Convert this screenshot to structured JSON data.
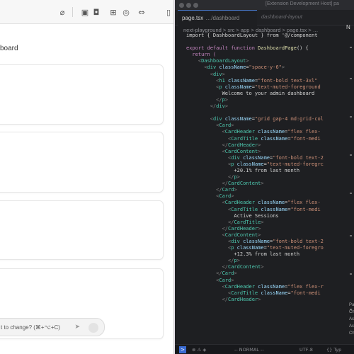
{
  "preview": {
    "board_text": "board",
    "toolbar_icons": [
      {
        "name": "attach-icon",
        "glyph": "⌀"
      },
      {
        "name": "screenshot-icon",
        "glyph": "▣"
      },
      {
        "name": "camera-icon",
        "glyph": "◘"
      },
      {
        "name": "grid-icon",
        "glyph": "⊞"
      },
      {
        "name": "target-icon",
        "glyph": "◎"
      },
      {
        "name": "expand-icon",
        "glyph": "⇔"
      },
      {
        "name": "sidebar-icon",
        "glyph": "▯"
      }
    ],
    "chat_placeholder": "t to change? (⌘+⌥+C)",
    "send_icon": "➤"
  },
  "editor": {
    "window_title": "[Extension Development Host] pa",
    "tab_active": {
      "name": "page.tsx",
      "path": "…/dashboard"
    },
    "tab_inactive": "dashboard-layout",
    "right_panel_label": "N",
    "breadcrumb": "next-playground > src > app > dashboard > page.tsx > …",
    "code_lines": [
      [
        {
          "t": "import { DashboardLayout } from '@/component",
          "c": "plain"
        }
      ],
      [],
      [
        {
          "t": "export default function ",
          "c": "kw"
        },
        {
          "t": "DashboardPage",
          "c": "fn"
        },
        {
          "t": "() {",
          "c": "plain"
        }
      ],
      [
        {
          "t": "  return (",
          "c": "kw"
        }
      ],
      [
        {
          "t": "    <",
          "c": "punc"
        },
        {
          "t": "DashboardLayout",
          "c": "tag"
        },
        {
          "t": ">",
          "c": "punc"
        }
      ],
      [
        {
          "t": "      <",
          "c": "punc"
        },
        {
          "t": "div ",
          "c": "tag"
        },
        {
          "t": "className",
          "c": "attr"
        },
        {
          "t": "=",
          "c": "plain"
        },
        {
          "t": "\"space-y-6\"",
          "c": "str"
        },
        {
          "t": ">",
          "c": "punc"
        }
      ],
      [
        {
          "t": "        <",
          "c": "punc"
        },
        {
          "t": "div",
          "c": "tag"
        },
        {
          "t": ">",
          "c": "punc"
        }
      ],
      [
        {
          "t": "          <",
          "c": "punc"
        },
        {
          "t": "h1 ",
          "c": "tag"
        },
        {
          "t": "className",
          "c": "attr"
        },
        {
          "t": "=",
          "c": "plain"
        },
        {
          "t": "\"font-bold text-3xl\"",
          "c": "str"
        }
      ],
      [
        {
          "t": "          <",
          "c": "punc"
        },
        {
          "t": "p ",
          "c": "tag"
        },
        {
          "t": "className",
          "c": "attr"
        },
        {
          "t": "=",
          "c": "plain"
        },
        {
          "t": "\"text-muted-foreground",
          "c": "str"
        }
      ],
      [
        {
          "t": "            Welcome to your admin dashboard",
          "c": "plain"
        }
      ],
      [
        {
          "t": "          </",
          "c": "punc"
        },
        {
          "t": "p",
          "c": "tag"
        },
        {
          "t": ">",
          "c": "punc"
        }
      ],
      [
        {
          "t": "        </",
          "c": "punc"
        },
        {
          "t": "div",
          "c": "tag"
        },
        {
          "t": ">",
          "c": "punc"
        }
      ],
      [],
      [
        {
          "t": "        <",
          "c": "punc"
        },
        {
          "t": "div ",
          "c": "tag"
        },
        {
          "t": "className",
          "c": "attr"
        },
        {
          "t": "=",
          "c": "plain"
        },
        {
          "t": "\"grid gap-4 md:grid-col",
          "c": "str"
        }
      ],
      [
        {
          "t": "          <",
          "c": "punc"
        },
        {
          "t": "Card",
          "c": "tag"
        },
        {
          "t": ">",
          "c": "punc"
        }
      ],
      [
        {
          "t": "            <",
          "c": "punc"
        },
        {
          "t": "CardHeader ",
          "c": "tag"
        },
        {
          "t": "className",
          "c": "attr"
        },
        {
          "t": "=",
          "c": "plain"
        },
        {
          "t": "\"flex flex-",
          "c": "str"
        }
      ],
      [
        {
          "t": "              <",
          "c": "punc"
        },
        {
          "t": "CardTitle ",
          "c": "tag"
        },
        {
          "t": "className",
          "c": "attr"
        },
        {
          "t": "=",
          "c": "plain"
        },
        {
          "t": "\"font-medi",
          "c": "str"
        }
      ],
      [
        {
          "t": "            </",
          "c": "punc"
        },
        {
          "t": "CardHeader",
          "c": "tag"
        },
        {
          "t": ">",
          "c": "punc"
        }
      ],
      [
        {
          "t": "            <",
          "c": "punc"
        },
        {
          "t": "CardContent",
          "c": "tag"
        },
        {
          "t": ">",
          "c": "punc"
        }
      ],
      [
        {
          "t": "              <",
          "c": "punc"
        },
        {
          "t": "div ",
          "c": "tag"
        },
        {
          "t": "className",
          "c": "attr"
        },
        {
          "t": "=",
          "c": "plain"
        },
        {
          "t": "\"font-bold text-2",
          "c": "str"
        }
      ],
      [
        {
          "t": "              <",
          "c": "punc"
        },
        {
          "t": "p ",
          "c": "tag"
        },
        {
          "t": "className",
          "c": "attr"
        },
        {
          "t": "=",
          "c": "plain"
        },
        {
          "t": "\"text-muted-foregrc",
          "c": "str"
        }
      ],
      [
        {
          "t": "                +20.1% from last month",
          "c": "plain"
        }
      ],
      [
        {
          "t": "              </",
          "c": "punc"
        },
        {
          "t": "p",
          "c": "tag"
        },
        {
          "t": ">",
          "c": "punc"
        }
      ],
      [
        {
          "t": "            </",
          "c": "punc"
        },
        {
          "t": "CardContent",
          "c": "tag"
        },
        {
          "t": ">",
          "c": "punc"
        }
      ],
      [
        {
          "t": "          </",
          "c": "punc"
        },
        {
          "t": "Card",
          "c": "tag"
        },
        {
          "t": ">",
          "c": "punc"
        }
      ],
      [
        {
          "t": "          <",
          "c": "punc"
        },
        {
          "t": "Card",
          "c": "tag"
        },
        {
          "t": ">",
          "c": "punc"
        }
      ],
      [
        {
          "t": "            <",
          "c": "punc"
        },
        {
          "t": "CardHeader ",
          "c": "tag"
        },
        {
          "t": "className",
          "c": "attr"
        },
        {
          "t": "=",
          "c": "plain"
        },
        {
          "t": "\"flex flex-",
          "c": "str"
        }
      ],
      [
        {
          "t": "              <",
          "c": "punc"
        },
        {
          "t": "CardTitle ",
          "c": "tag"
        },
        {
          "t": "className",
          "c": "attr"
        },
        {
          "t": "=",
          "c": "plain"
        },
        {
          "t": "\"font-medi",
          "c": "str"
        }
      ],
      [
        {
          "t": "                Active Sessions",
          "c": "plain"
        }
      ],
      [
        {
          "t": "              </",
          "c": "punc"
        },
        {
          "t": "CardTitle",
          "c": "tag"
        },
        {
          "t": ">",
          "c": "punc"
        }
      ],
      [
        {
          "t": "            </",
          "c": "punc"
        },
        {
          "t": "CardHeader",
          "c": "tag"
        },
        {
          "t": ">",
          "c": "punc"
        }
      ],
      [
        {
          "t": "            <",
          "c": "punc"
        },
        {
          "t": "CardContent",
          "c": "tag"
        },
        {
          "t": ">",
          "c": "punc"
        }
      ],
      [
        {
          "t": "              <",
          "c": "punc"
        },
        {
          "t": "div ",
          "c": "tag"
        },
        {
          "t": "className",
          "c": "attr"
        },
        {
          "t": "=",
          "c": "plain"
        },
        {
          "t": "\"font-bold text-2",
          "c": "str"
        }
      ],
      [
        {
          "t": "              <",
          "c": "punc"
        },
        {
          "t": "p ",
          "c": "tag"
        },
        {
          "t": "className",
          "c": "attr"
        },
        {
          "t": "=",
          "c": "plain"
        },
        {
          "t": "\"text-muted-foregro",
          "c": "str"
        }
      ],
      [
        {
          "t": "                +12.3% from last month",
          "c": "plain"
        }
      ],
      [
        {
          "t": "              </",
          "c": "punc"
        },
        {
          "t": "p",
          "c": "tag"
        },
        {
          "t": ">",
          "c": "punc"
        }
      ],
      [
        {
          "t": "            </",
          "c": "punc"
        },
        {
          "t": "CardContent",
          "c": "tag"
        },
        {
          "t": ">",
          "c": "punc"
        }
      ],
      [
        {
          "t": "          </",
          "c": "punc"
        },
        {
          "t": "Card",
          "c": "tag"
        },
        {
          "t": ">",
          "c": "punc"
        }
      ],
      [
        {
          "t": "          <",
          "c": "punc"
        },
        {
          "t": "Card",
          "c": "tag"
        },
        {
          "t": ">",
          "c": "punc"
        }
      ],
      [
        {
          "t": "            <",
          "c": "punc"
        },
        {
          "t": "CardHeader ",
          "c": "tag"
        },
        {
          "t": "className",
          "c": "attr"
        },
        {
          "t": "=",
          "c": "plain"
        },
        {
          "t": "\"flex flex-r",
          "c": "str"
        }
      ],
      [
        {
          "t": "              <",
          "c": "punc"
        },
        {
          "t": "CardTitle ",
          "c": "tag"
        },
        {
          "t": "className",
          "c": "attr"
        },
        {
          "t": "=",
          "c": "plain"
        },
        {
          "t": "\"font-medi",
          "c": "str"
        }
      ],
      [
        {
          "t": "            </",
          "c": "punc"
        },
        {
          "t": "CardHeader",
          "c": "tag"
        },
        {
          "t": ">",
          "c": "punc"
        }
      ]
    ],
    "status": {
      "mode": "-- NORMAL --",
      "encoding": "UTF-8",
      "lang": "{} Typ",
      "remote_glyph": "><"
    },
    "right_panel_items": [
      "Pa",
      "Ch",
      "Ac",
      "Ac",
      "Ch"
    ]
  },
  "colors": {
    "keyword": "#c586c0",
    "function": "#dcdcaa",
    "tag": "#4ec9b0",
    "attribute": "#9cdcfe",
    "string": "#ce9178",
    "accent": "#3a6bd1"
  }
}
